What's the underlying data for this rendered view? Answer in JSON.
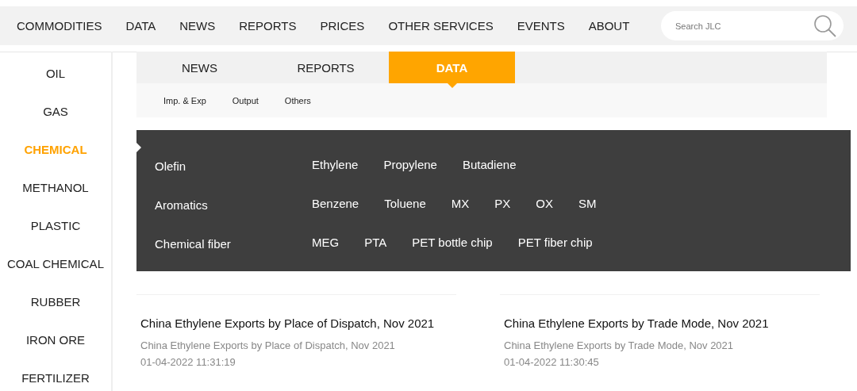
{
  "nav": {
    "items": [
      {
        "label": "COMMODITIES"
      },
      {
        "label": "DATA"
      },
      {
        "label": "NEWS"
      },
      {
        "label": "REPORTS"
      },
      {
        "label": "PRICES"
      },
      {
        "label": "OTHER SERVICES"
      },
      {
        "label": "EVENTS"
      },
      {
        "label": "ABOUT"
      }
    ],
    "search": {
      "placeholder": "Search JLC"
    }
  },
  "sidebar": {
    "items": [
      {
        "label": "OIL",
        "selected": false
      },
      {
        "label": "GAS",
        "selected": false
      },
      {
        "label": "CHEMICAL",
        "selected": true
      },
      {
        "label": "METHANOL",
        "selected": false
      },
      {
        "label": "PLASTIC",
        "selected": false
      },
      {
        "label": "COAL CHEMICAL",
        "selected": false
      },
      {
        "label": "RUBBER",
        "selected": false
      },
      {
        "label": "IRON ORE",
        "selected": false
      },
      {
        "label": "FERTILIZER",
        "selected": false
      }
    ]
  },
  "tabs": [
    {
      "label": "NEWS",
      "selected": false
    },
    {
      "label": "REPORTS",
      "selected": false
    },
    {
      "label": "DATA",
      "selected": true
    }
  ],
  "subtabs": [
    {
      "label": "Imp. & Exp"
    },
    {
      "label": "Output"
    },
    {
      "label": "Others"
    }
  ],
  "flyout": {
    "groups": [
      {
        "label": "Olefin",
        "items": [
          "Ethylene",
          "Propylene",
          "Butadiene"
        ]
      },
      {
        "label": "Aromatics",
        "items": [
          "Benzene",
          "Toluene",
          "MX",
          "PX",
          "OX",
          "SM"
        ]
      },
      {
        "label": "Chemical fiber",
        "items": [
          "MEG",
          "PTA",
          "PET bottle chip",
          "PET fiber chip"
        ]
      }
    ]
  },
  "articles": [
    {
      "title": "China Ethylene Exports by Place of Dispatch, Nov 2021",
      "summary": "China Ethylene Exports by Place of Dispatch, Nov 2021",
      "date": "01-04-2022 11:31:19"
    },
    {
      "title": "China Ethylene Exports by Trade Mode, Nov 2021",
      "summary": "China Ethylene Exports by Trade Mode, Nov 2021",
      "date": "01-04-2022 11:30:45"
    }
  ]
}
